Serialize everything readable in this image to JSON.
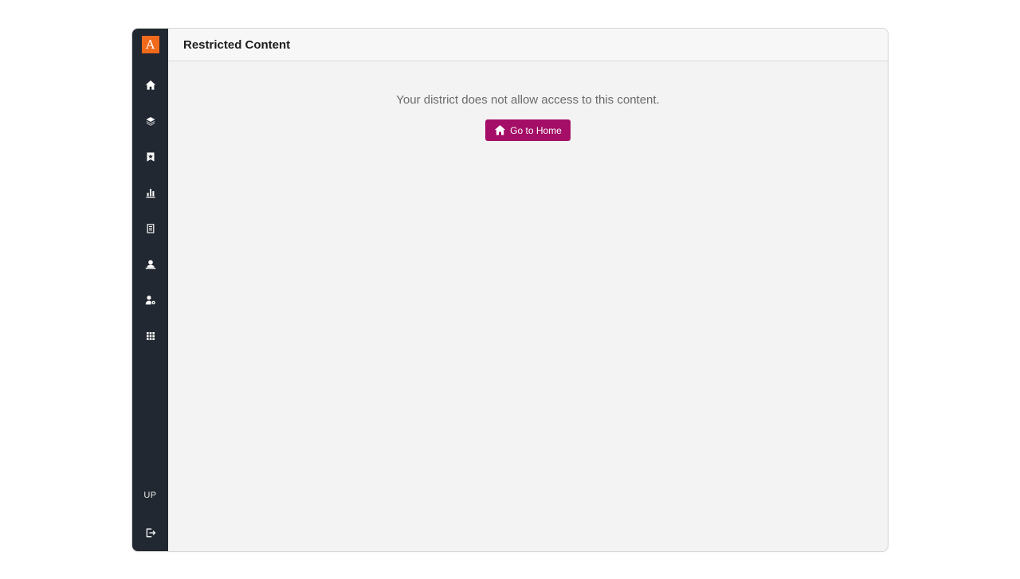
{
  "sidebar": {
    "logo_text": "A",
    "logo_color": "#f06a1c",
    "background_color": "#222831",
    "items": [
      {
        "icon": "home-icon"
      },
      {
        "icon": "layers-icon"
      },
      {
        "icon": "bookmark-icon"
      },
      {
        "icon": "bar-chart-icon"
      },
      {
        "icon": "document-icon"
      },
      {
        "icon": "teacher-icon"
      },
      {
        "icon": "user-settings-icon"
      },
      {
        "icon": "apps-grid-icon"
      }
    ],
    "user_initials": "UP",
    "logout_icon": "logout-icon"
  },
  "header": {
    "title": "Restricted Content"
  },
  "main": {
    "message": "Your district does not allow access to this content.",
    "button": {
      "label": "Go to Home",
      "icon": "home-icon",
      "color": "#a40e67"
    }
  }
}
